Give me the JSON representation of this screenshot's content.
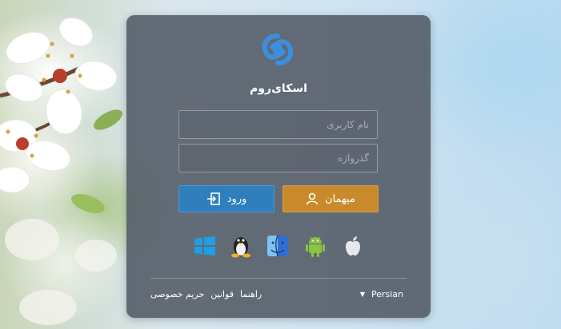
{
  "app": {
    "title": "اسکای‌روم"
  },
  "login": {
    "username_placeholder": "نام کاربری",
    "password_placeholder": "گذرواژه",
    "login_label": "ورود",
    "guest_label": "میهمان"
  },
  "platforms": [
    "windows-icon",
    "linux-icon",
    "macos-finder-icon",
    "android-icon",
    "apple-icon"
  ],
  "footer": {
    "links": [
      "راهنما",
      "قوانین",
      "حریم خصوصی"
    ],
    "language": "Persian"
  },
  "colors": {
    "login_button": "#2f7fbd",
    "guest_button": "#c88a2b",
    "panel": "#4e5662",
    "logo": "#3b8fe0"
  }
}
